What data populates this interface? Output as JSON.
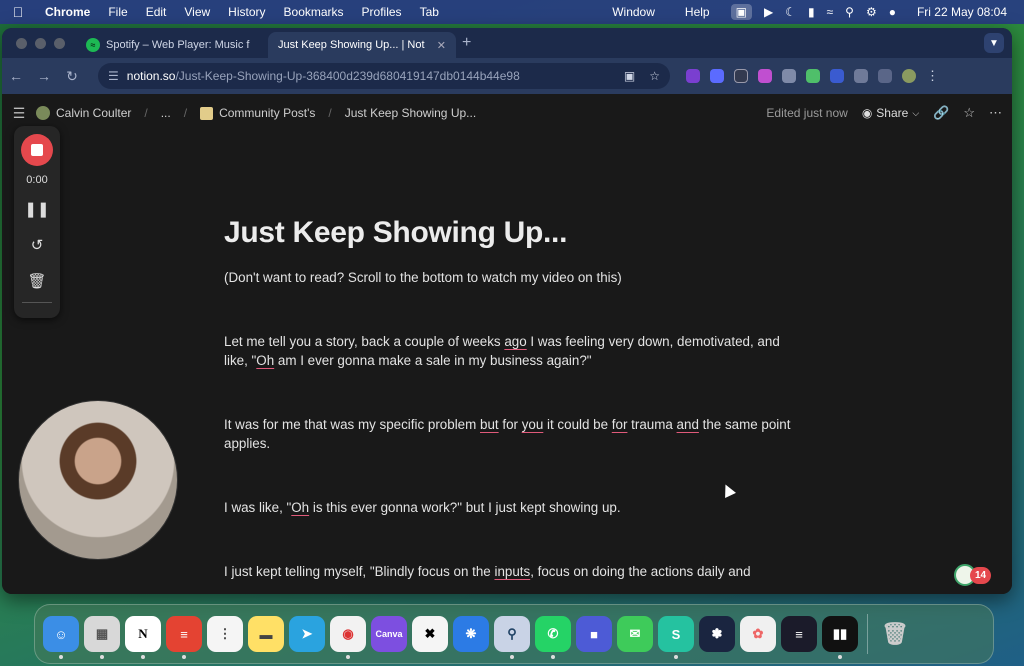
{
  "menubar": {
    "app": "Chrome",
    "items": [
      "File",
      "Edit",
      "View",
      "History",
      "Bookmarks",
      "Profiles",
      "Tab"
    ],
    "right_items": [
      "Window",
      "Help"
    ],
    "datetime": "Fri 22 May  08:04"
  },
  "browser": {
    "tabs": [
      {
        "title": "Spotify – Web Player: Music f",
        "icon": "spotify-icon"
      },
      {
        "title": "Just Keep Showing Up... | Not",
        "icon": "notion-icon"
      }
    ],
    "url_host": "notion.so",
    "url_path": "/Just-Keep-Showing-Up-368400d239d680419147db0144b44e98"
  },
  "notion": {
    "breadcrumb": [
      "Calvin Coulter",
      "...",
      "Community Post's",
      "Just Keep Showing Up..."
    ],
    "edited": "Edited just now",
    "share": "Share",
    "title": "Just Keep Showing Up...",
    "paragraphs": {
      "p1": "(Don't want to read? Scroll to the bottom to watch my video on this)",
      "p2a": "Let me tell you a story, back a couple of weeks ",
      "p2b": "ago",
      "p2c": " I was feeling very down, demotivated, and like, \"",
      "p2d": "Oh",
      "p2e": " am I ever gonna make a sale in my business again?\"",
      "p3a": " It was for me that was my specific problem ",
      "p3b": "but",
      "p3c": " for ",
      "p3d": "you",
      "p3e": " it could be ",
      "p3f": "for",
      "p3g": " trauma ",
      "p3h": "and",
      "p3i": " the same point applies.",
      "p4a": "I was like, \"",
      "p4b": "Oh",
      "p4c": " is this ever gonna work?\" but I just kept showing up.",
      "p5a": " I just kept telling myself, \"Blindly focus on the ",
      "p5b": "inputs",
      "p5c": ", focus on doing the actions daily and"
    }
  },
  "recorder": {
    "time": "0:00"
  },
  "widgets": {
    "badge_count": "14"
  },
  "dock": {
    "apps": [
      "Finder",
      "Launchpad",
      "Notion",
      "Todoist",
      "Reminders",
      "Notes",
      "Telegram",
      "Chrome",
      "Canva",
      "CapCut",
      "App",
      "App",
      "WhatsApp",
      "App",
      "Messages",
      "App",
      "App",
      "Photos",
      "App",
      "App"
    ]
  },
  "colors": {
    "accent_record": "#e5484d",
    "notion_bg": "#191919",
    "underline": "#e05a7a"
  }
}
